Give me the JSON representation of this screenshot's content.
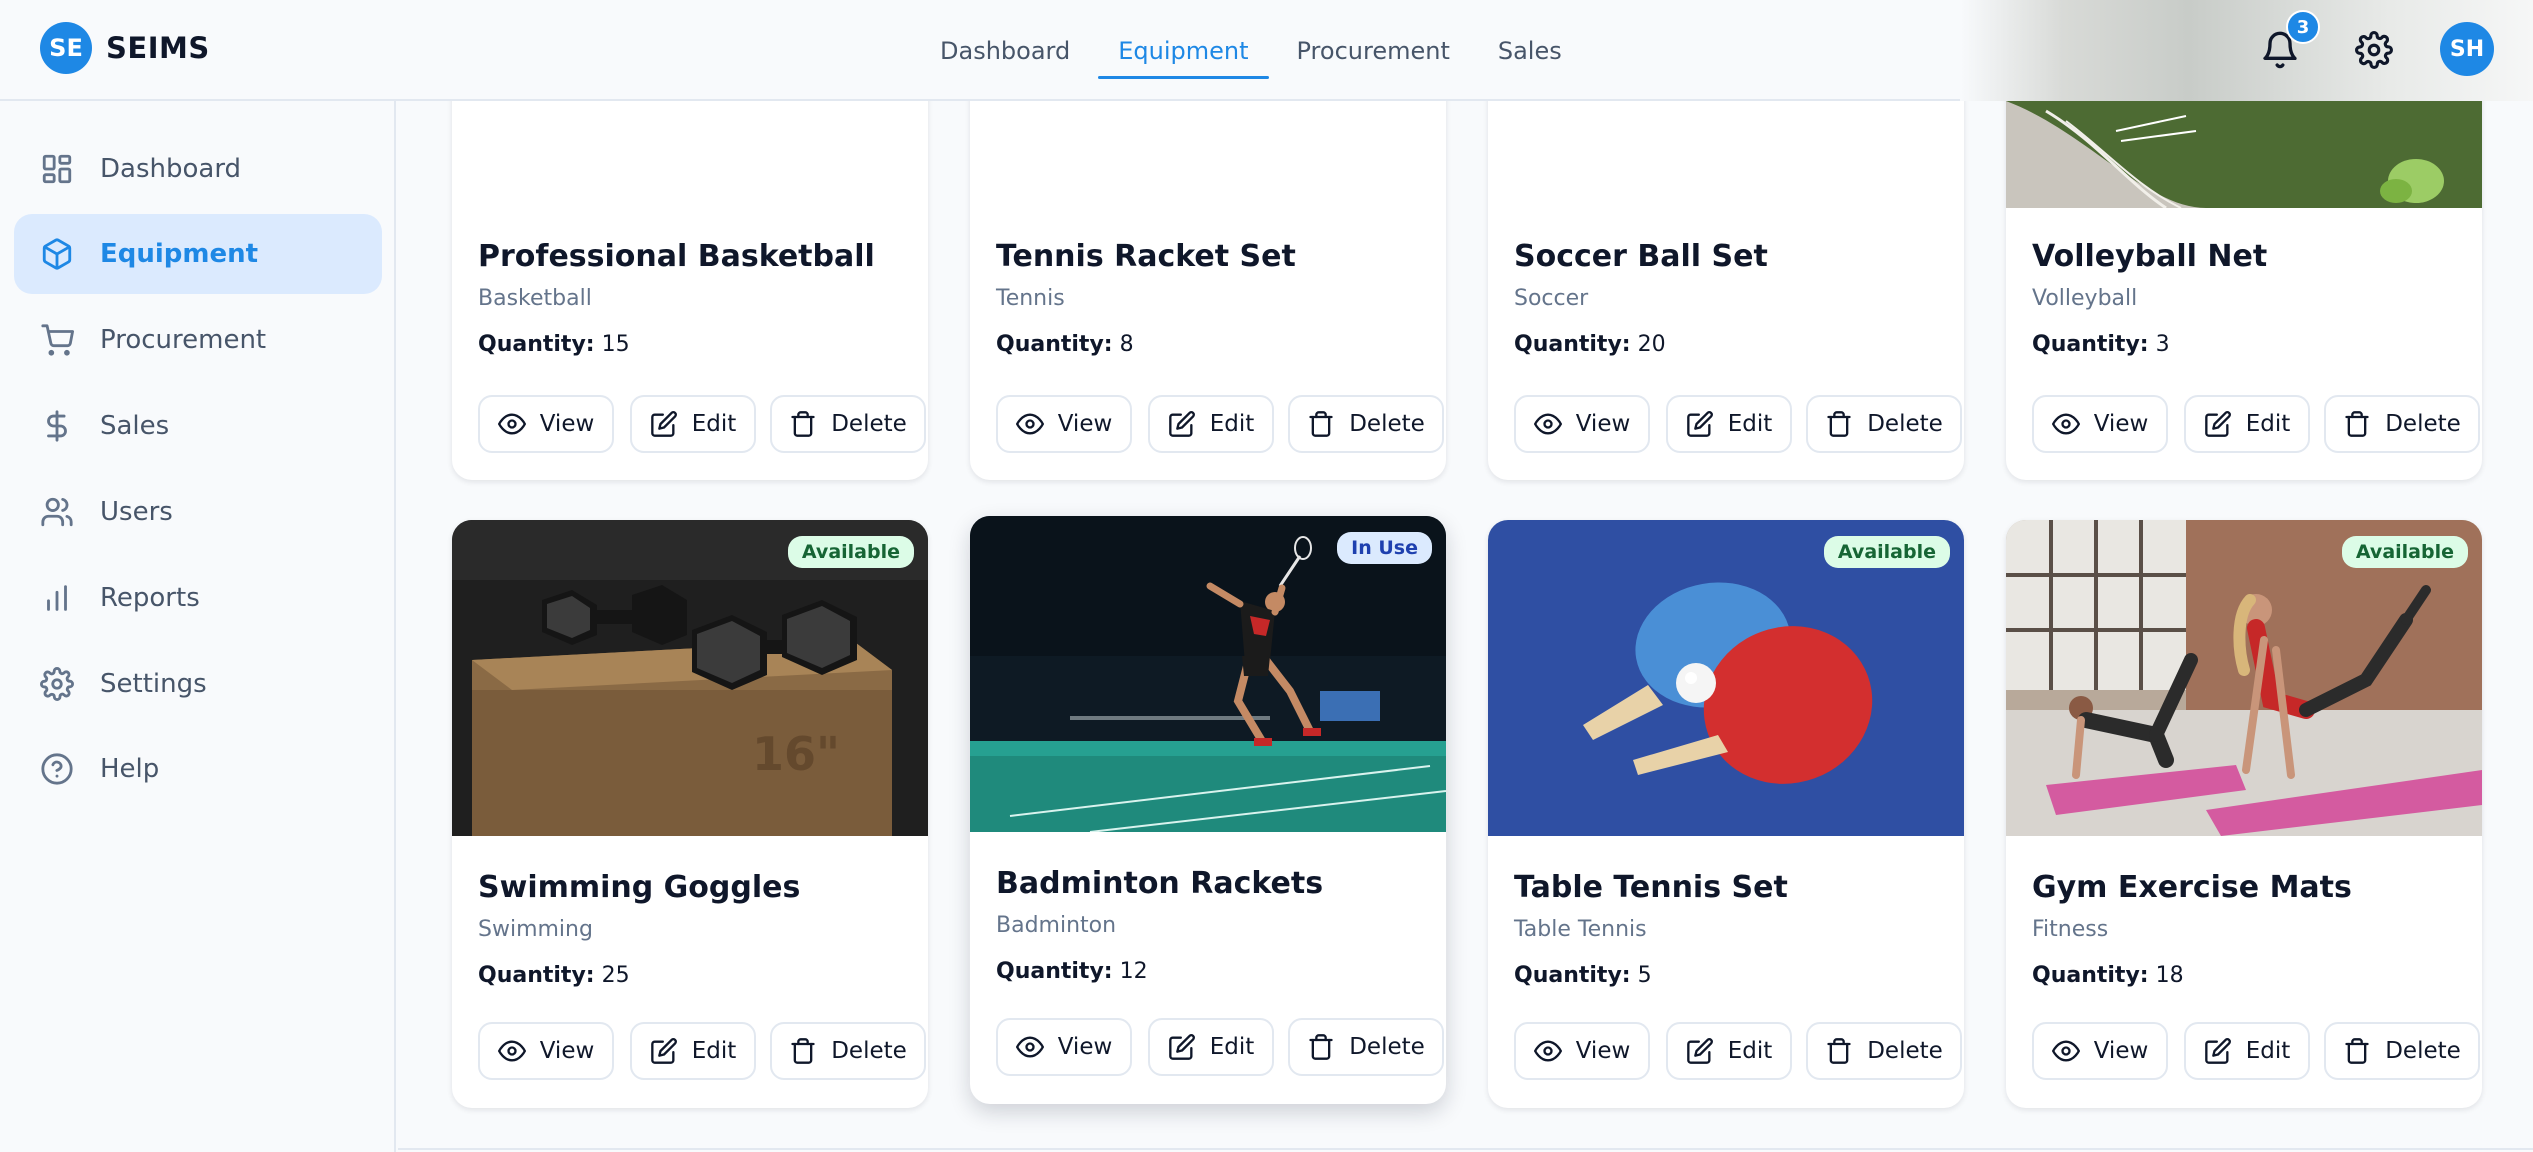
{
  "brand": {
    "logo_text": "SE",
    "name": "SEIMS"
  },
  "topnav": {
    "items": [
      {
        "label": "Dashboard",
        "active": false
      },
      {
        "label": "Equipment",
        "active": true
      },
      {
        "label": "Procurement",
        "active": false
      },
      {
        "label": "Sales",
        "active": false
      }
    ]
  },
  "header": {
    "notifications_count": "3",
    "avatar_initials": "SH"
  },
  "sidebar": {
    "items": [
      {
        "label": "Dashboard",
        "icon": "grid-icon",
        "active": false
      },
      {
        "label": "Equipment",
        "icon": "box-icon",
        "active": true
      },
      {
        "label": "Procurement",
        "icon": "cart-icon",
        "active": false
      },
      {
        "label": "Sales",
        "icon": "dollar-icon",
        "active": false
      },
      {
        "label": "Users",
        "icon": "users-icon",
        "active": false
      },
      {
        "label": "Reports",
        "icon": "bar-chart-icon",
        "active": false
      },
      {
        "label": "Settings",
        "icon": "gear-icon",
        "active": false
      },
      {
        "label": "Help",
        "icon": "help-circle-icon",
        "active": false
      }
    ]
  },
  "actions": {
    "view": "View",
    "edit": "Edit",
    "delete": "Delete"
  },
  "quantity_label": "Quantity:",
  "colors": {
    "accent": "#1e88e5",
    "available_bg": "#dcfce7",
    "in_use_bg": "#dbeafe"
  },
  "cards": [
    {
      "title": "Professional Basketball",
      "category": "Basketball",
      "quantity": "15"
    },
    {
      "title": "Tennis Racket Set",
      "category": "Tennis",
      "quantity": "8"
    },
    {
      "title": "Soccer Ball Set",
      "category": "Soccer",
      "quantity": "20"
    },
    {
      "title": "Volleyball Net",
      "category": "Volleyball",
      "quantity": "3"
    },
    {
      "title": "Swimming Goggles",
      "category": "Swimming",
      "quantity": "25",
      "status": "Available"
    },
    {
      "title": "Badminton Rackets",
      "category": "Badminton",
      "quantity": "12",
      "status": "In Use"
    },
    {
      "title": "Table Tennis Set",
      "category": "Table Tennis",
      "quantity": "5",
      "status": "Available"
    },
    {
      "title": "Gym Exercise Mats",
      "category": "Fitness",
      "quantity": "18",
      "status": "Available"
    }
  ]
}
